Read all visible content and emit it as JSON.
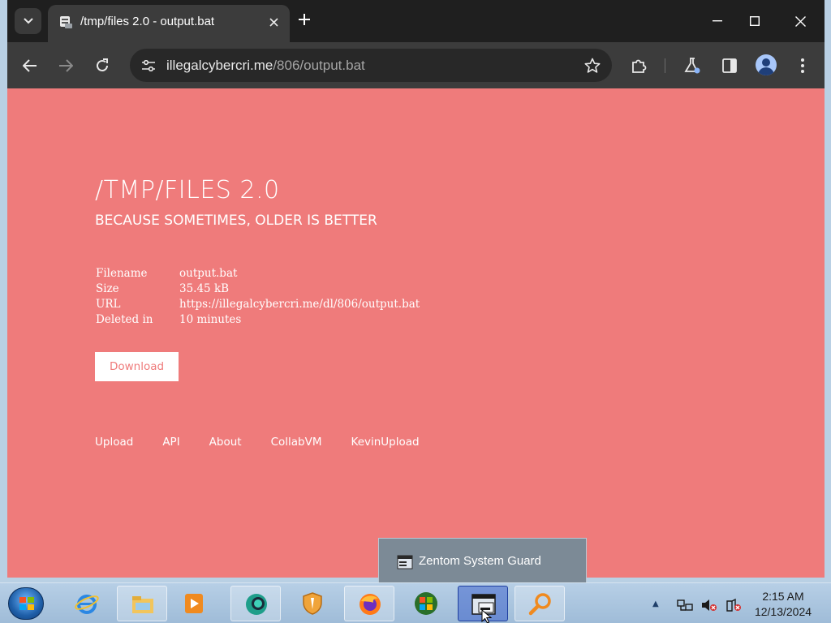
{
  "browser": {
    "tab": {
      "title": "/tmp/files 2.0 - output.bat",
      "favicon": "tmp-files-favicon-icon"
    },
    "address_bar": {
      "host": "illegalcybercri.me",
      "path": "/806/output.bat"
    },
    "icons": {
      "tab_search": "chevron-down-icon",
      "new_tab": "plus-icon",
      "back": "back-arrow-icon",
      "forward": "forward-arrow-icon",
      "reload": "reload-icon",
      "site_info": "tune-icon",
      "bookmark": "star-icon",
      "extensions": "puzzle-icon",
      "labs": "flask-icon",
      "side_panel": "side-panel-icon",
      "profile": "profile-icon",
      "menu": "kebab-menu-icon"
    }
  },
  "page": {
    "title": "/TMP/FILES 2.0",
    "subtitle": "BECAUSE SOMETIMES, OLDER IS BETTER",
    "info": [
      {
        "key": "Filename",
        "value": "output.bat"
      },
      {
        "key": "Size",
        "value": "35.45 kB"
      },
      {
        "key": "URL",
        "value": "https://illegalcybercri.me/dl/806/output.bat"
      },
      {
        "key": "Deleted in",
        "value": "10 minutes"
      }
    ],
    "download_label": "Download",
    "footer_links": [
      "Upload",
      "API",
      "About",
      "CollabVM",
      "KevinUpload"
    ],
    "background_color": "#ef7b7b"
  },
  "taskbar": {
    "popup_label": "Zentom System Guard",
    "clock_time": "2:15 AM",
    "clock_date": "12/13/2024",
    "items": [
      "internet-explorer-icon",
      "file-explorer-icon",
      "media-player-icon",
      "chat-app-icon",
      "security-shield-icon",
      "firefox-icon",
      "windows-icon",
      "window-app-icon",
      "search-tool-icon"
    ]
  }
}
